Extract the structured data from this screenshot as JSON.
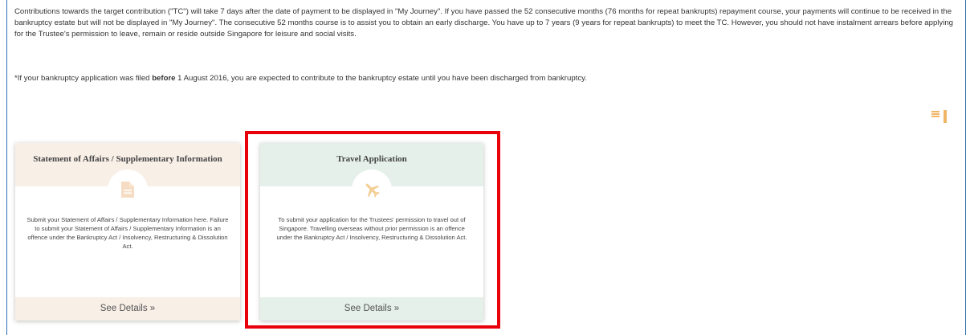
{
  "intro": {
    "paragraph": "Contributions towards the target contribution (\"TC\") will take 7 days after the date of payment to be displayed in \"My Journey\". If you have passed the 52 consecutive months (76 months for repeat bankrupts) repayment course, your payments will continue to be received in the bankruptcy estate but will not be displayed in \"My Journey\". The consecutive 52 months course is to assist you to obtain an early discharge. You have up to 7 years (9 years for repeat bankrupts) to meet the TC. However, you should not have instalment arrears before applying for the Trustee's permission to leave, remain or reside outside Singapore for leisure and social visits.",
    "note_prefix": "*If your bankruptcy application was filed ",
    "note_bold": "before",
    "note_suffix": " 1 August 2016, you are expected to contribute to the bankruptcy estate until you have been discharged from bankruptcy."
  },
  "view_toggle": {
    "list_icon": "list-view-icon",
    "grid_icon": "grid-view-icon",
    "color": "#f1b566"
  },
  "cards": [
    {
      "title": "Statement of Affairs / Supplementary Information",
      "icon": "document-icon",
      "description": "Submit your Statement of Affairs / Supplementary Information here. Failure to submit your Statement of Affairs / Supplementary Information is an offence under the Bankruptcy Act / Insolvency, Restructuring & Dissolution Act.",
      "link": "See Details »",
      "accent": "#f8efe7"
    },
    {
      "title": "Travel Application",
      "icon": "airplane-icon",
      "description": "To submit your application for the Trustees' permission to travel out of Singapore. Travelling overseas without prior permission is an offence under the Bankruptcy Act / Insolvency, Restructuring & Dissolution Act.",
      "link": "See Details »",
      "accent": "#e5f0ea"
    }
  ],
  "highlight_color": "#e8000b"
}
